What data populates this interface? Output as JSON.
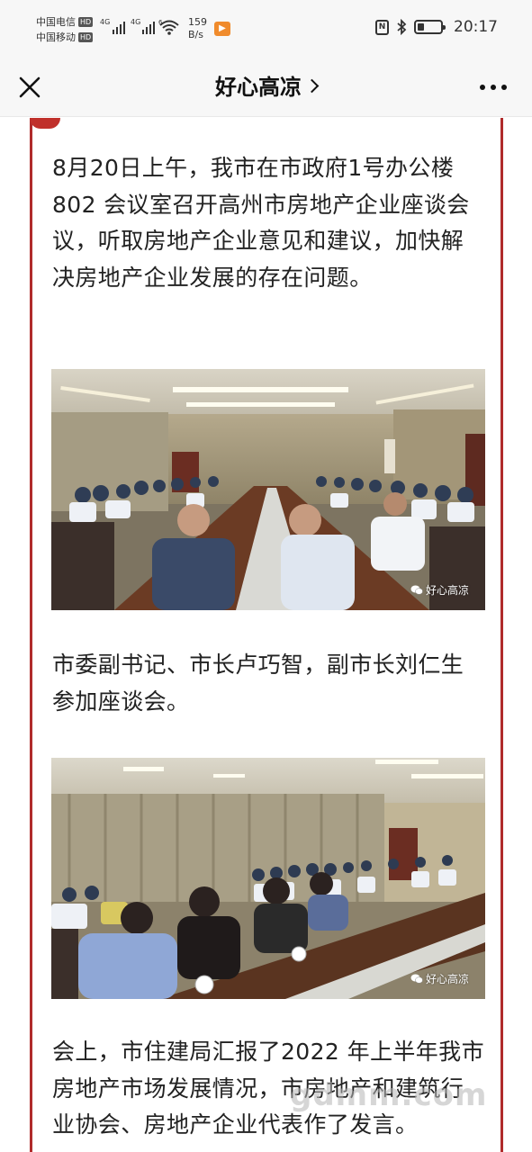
{
  "status_bar": {
    "carrier1": "中国电信",
    "carrier2": "中国移动",
    "hd": "HD",
    "net1": "4G",
    "net2": "4G",
    "wifi_level": "6",
    "speed_value": "159",
    "speed_unit": "B/s",
    "time": "20:17",
    "icons": [
      "nfc-icon",
      "bluetooth-icon",
      "battery-icon",
      "wifi-icon"
    ]
  },
  "header": {
    "title": "好心高凉",
    "close_icon": "close-icon",
    "more_icon": "more-icon"
  },
  "article": {
    "paragraph1": "8月20日上午，我市在市政府1号办公楼 802 会议室召开高州市房地产企业座谈会议，听取房地产企业意见和建议，加快解决房地产企业发展的存在问题。",
    "photo1_watermark": "好心高凉",
    "paragraph2": "市委副书记、市长卢巧智，副市长刘仁生参加座谈会。",
    "photo2_watermark": "好心高凉",
    "paragraph3": "会上，市住建局汇报了2022 年上半年我市房地产市场发展情况，市房地产和建筑行业协会、房地产企业代表作了发言。"
  },
  "site_watermark": "gdmm.com",
  "colors": {
    "accent_border": "#b02b2b",
    "app_badge": "#f08b2c"
  }
}
